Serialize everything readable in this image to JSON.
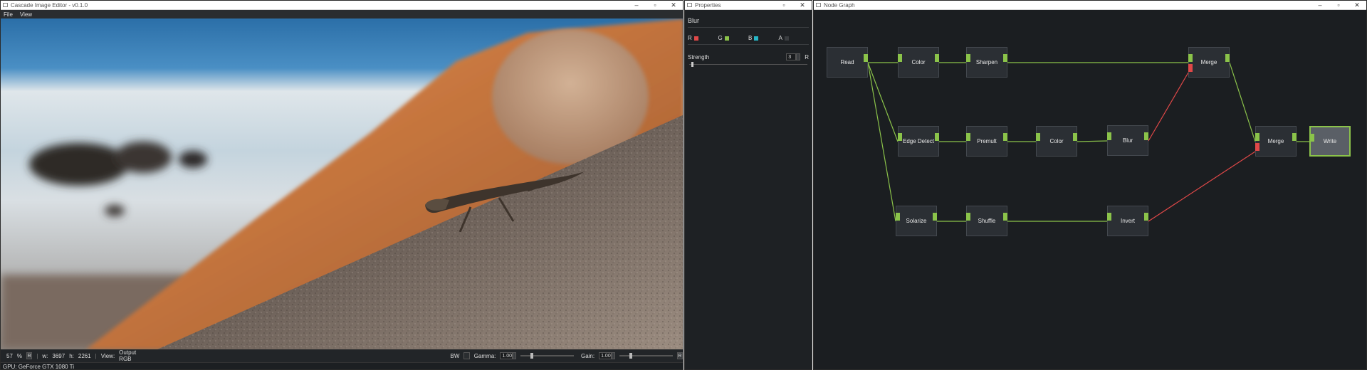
{
  "viewer": {
    "title": "Cascade Image Editor - v0.1.0",
    "menu": [
      "File",
      "View"
    ],
    "status": {
      "zoom": "57",
      "zoom_unit": "%",
      "reset": "R",
      "w_label": "w:",
      "w_value": "3697",
      "h_label": "h:",
      "h_value": "2261",
      "view_label": "View:",
      "view_value": "Output RGB",
      "bw_label": "BW",
      "gamma_label": "Gamma:",
      "gamma_value": "1.00",
      "gamma_level": 0.15,
      "gain_label": "Gain:",
      "gain_value": "1.00",
      "gain_level": 0.15,
      "reset2": "R"
    },
    "gpu": "GPU: GeForce GTX 1080 Ti"
  },
  "properties": {
    "title": "Properties",
    "node_title": "Blur",
    "channels": [
      {
        "label": "R",
        "color": "#e04848"
      },
      {
        "label": "G",
        "color": "#8bc34a"
      },
      {
        "label": "B",
        "color": "#26b6c6"
      },
      {
        "label": "A",
        "color": "#3a3d40"
      }
    ],
    "strength_label": "Strength",
    "strength_value": "3",
    "strength_reset": "R",
    "strength_level": 0.03
  },
  "graph": {
    "title": "Node Graph",
    "nodes": {
      "read": "Read",
      "color1": "Color",
      "sharpen": "Sharpen",
      "merge1": "Merge",
      "edge": "Edge Detect",
      "premult": "Premult",
      "color2": "Color",
      "blur": "Blur",
      "merge2": "Merge",
      "write": "Write",
      "solarize": "Solarize",
      "shuffle": "Shuffle",
      "invert": "Invert"
    }
  },
  "colors": {
    "accent": "#8bc34a",
    "error": "#e04848"
  }
}
